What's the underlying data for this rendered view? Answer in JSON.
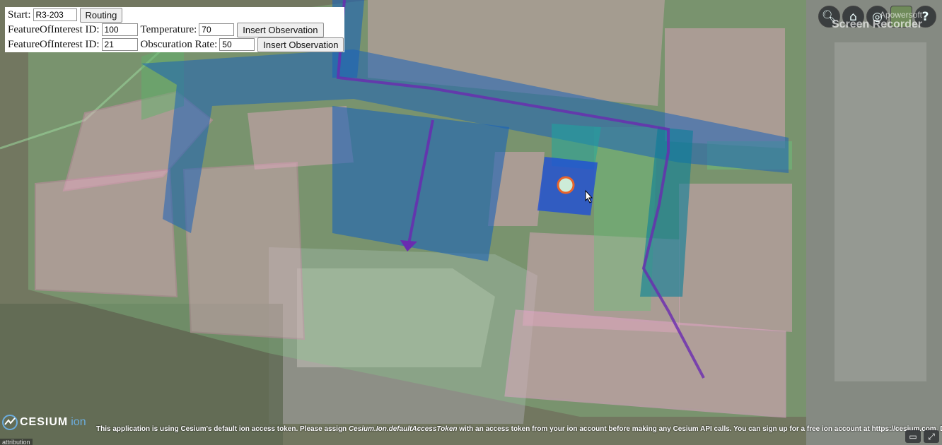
{
  "form": {
    "start_label": "Start:",
    "start_value": "R3-203",
    "routing_button": "Routing",
    "foi_label": "FeatureOfInterest ID:",
    "foi1_value": "100",
    "temperature_label": "Temperature:",
    "temperature_value": "70",
    "insert1_button": "Insert Observation",
    "foi2_value": "21",
    "obscuration_label": "Obscuration Rate:",
    "obscuration_value": "50",
    "insert2_button": "Insert Observation"
  },
  "toolbar": {
    "icons": [
      "geocoder-search-icon",
      "home-icon",
      "scene-mode-globe-icon",
      "base-layer-picker-icon",
      "help-icon"
    ],
    "help_label": "?",
    "watermark_line1": "Apowersoft",
    "watermark_line2": "Screen Recorder"
  },
  "footer": {
    "logo_name": "CESIUM",
    "logo_ion": "ion",
    "credit_before": "This application is using Cesium's default ion access token. Please assign ",
    "credit_token": "Cesium.Ion.defaultAccessToken",
    "credit_after": " with an access token from your ion account before making any Cesium API calls. You can sign up for a free ion account at https://cesium.com. Dis",
    "attribution": "attribution"
  },
  "colors": {
    "room_pink": "#e7a9c4",
    "room_green": "#86c98a",
    "corridor_blue": "#1b62b8",
    "route_purple": "#6a2bb0",
    "marker_ring": "#e8642c",
    "marker_fill": "#cdecd8"
  }
}
